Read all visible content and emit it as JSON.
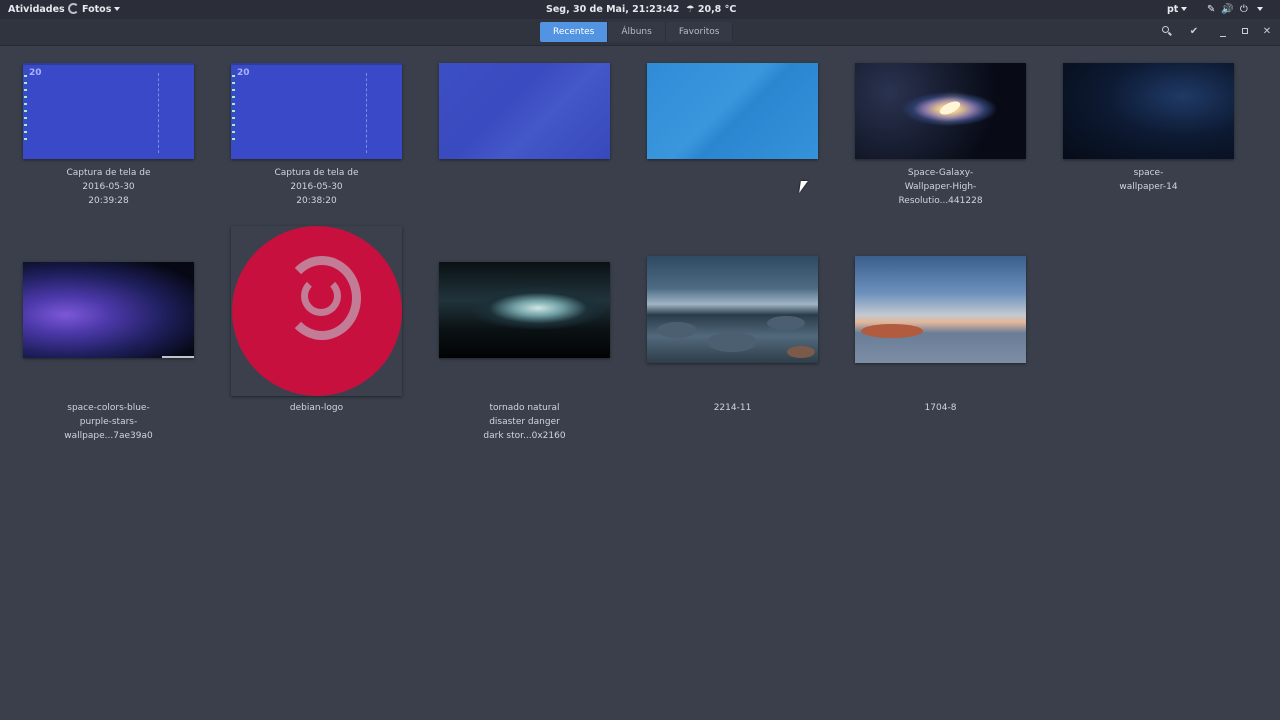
{
  "topbar": {
    "activities": "Atividades",
    "app_name": "Fotos",
    "clock": "Seg, 30 de Mai, 21:23:42",
    "weather": "20,8 °C",
    "weather_icon": "cloud-rain-icon",
    "language": "pt",
    "system_icons": [
      "pen-icon",
      "volume-icon",
      "power-icon"
    ]
  },
  "headerbar": {
    "tabs": [
      {
        "label": "Recentes",
        "active": true
      },
      {
        "label": "Álbuns",
        "active": false
      },
      {
        "label": "Favoritos",
        "active": false
      }
    ],
    "buttons": [
      "search-icon",
      "check-icon",
      "minimize-icon",
      "maximize-icon",
      "close-icon"
    ],
    "accent_color": "#5294e2"
  },
  "photos": [
    {
      "caption": [
        "Captura de tela de",
        "2016-05-30",
        "20:39:28"
      ],
      "thumb_text": "20"
    },
    {
      "caption": [
        "Captura de tela de",
        "2016-05-30",
        "20:38:20"
      ],
      "thumb_text": "20"
    },
    {
      "caption": []
    },
    {
      "caption": []
    },
    {
      "caption": [
        "Space-Galaxy-",
        "Wallpaper-High-",
        "Resolutio...441228"
      ]
    },
    {
      "caption": [
        "space-",
        "wallpaper-14"
      ]
    },
    {
      "caption": [
        "space-colors-blue-",
        "purple-stars-",
        "wallpape...7ae39a0"
      ]
    },
    {
      "caption": [
        "debian-logo"
      ]
    },
    {
      "caption": [
        "tornado natural",
        "disaster danger",
        "dark stor...0x2160"
      ]
    },
    {
      "caption": [
        "2214-11"
      ]
    },
    {
      "caption": [
        "1704-8"
      ]
    }
  ]
}
